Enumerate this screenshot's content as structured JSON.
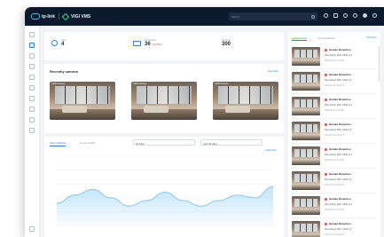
{
  "app": {
    "brand": "tp-link",
    "product": "VIGI VMS"
  },
  "topbar": {
    "search_placeholder": "Search"
  },
  "stats": [
    {
      "label": "Sites",
      "value": "4",
      "sub": ""
    },
    {
      "label": "All Devices",
      "value": "36",
      "sub": "12 Offline"
    },
    {
      "label": "All Alerts",
      "value": "300",
      "sub": ""
    }
  ],
  "recent": {
    "title": "Recently camera",
    "view_all": "View More",
    "cameras": [
      {
        "name": "C330 Camera"
      },
      {
        "name": "C330 Camera"
      },
      {
        "name": "C330 Camera"
      }
    ]
  },
  "alarm_chart": {
    "tabs": [
      "Alarm Statistic",
      "Device Health"
    ],
    "filters": [
      "All Sites",
      "Last 30 days"
    ],
    "legend": "Total Alarm"
  },
  "chart_data": {
    "type": "area",
    "x": [
      0,
      1,
      2,
      3,
      4,
      5,
      6,
      7,
      8,
      9,
      10,
      11,
      12
    ],
    "values": [
      8,
      11,
      13,
      10,
      7,
      9,
      12,
      9,
      7,
      9,
      11,
      10,
      14
    ],
    "ylim": [
      0,
      25
    ],
    "grid": true,
    "color": "#7cc4f4"
  },
  "events_panel": {
    "tabs": [
      "Latest Events",
      "Event Statistics"
    ],
    "more": "View More",
    "events": [
      {
        "title": "Human Detection",
        "device": "Dino Home NVC C340 1-2",
        "time": "2023-03-17 14:22:05"
      },
      {
        "title": "Human Detection",
        "device": "Dino Home NVC C340 1-2",
        "time": "2023-03-17 14:22:05"
      },
      {
        "title": "Human Detection",
        "device": "Dino Home NVC C340 1-2",
        "time": "2023-03-17 14:22:05"
      },
      {
        "title": "Human Detection",
        "device": "Dino Home NVC C340 1-2",
        "time": "2023-03-17 14:22:05"
      },
      {
        "title": "Human Detection",
        "device": "Dino Home NVC C340 1-2",
        "time": "2023-03-17 14:22:05"
      },
      {
        "title": "Human Detection",
        "device": "Dino Home NVC C340 1-2",
        "time": "2023-03-17 14:22:05"
      },
      {
        "title": "Human Detection",
        "device": "Dino Home NVC C340 1-2",
        "time": "2023-03-17 14:22:05"
      },
      {
        "title": "Human Detection",
        "device": "Dino Home NVC C340 1-2",
        "time": "2023-03-17 14:22:05"
      }
    ]
  },
  "colors": {
    "accent": "#1c87f5",
    "topbar": "#0d1a2e",
    "alert": "#e8473d"
  }
}
